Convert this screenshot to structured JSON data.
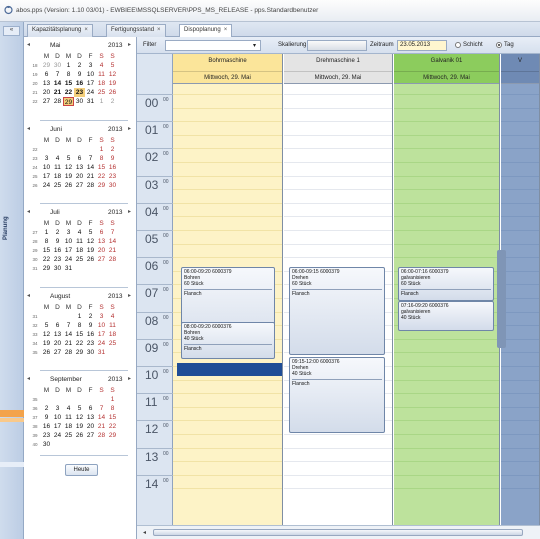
{
  "window": {
    "title": "abos.pps (Version: 1.10 03/01) - EWBIEE\\MSSQLSERVER\\PPS_MS_RELEASE - pps.Standardbenutzer"
  },
  "strip": {
    "top_button": "«",
    "label": "Planung"
  },
  "tabs": [
    {
      "label": "Kapazitätsplanung",
      "close": "×"
    },
    {
      "label": "Fertigungsstand",
      "close": "×"
    },
    {
      "label": "Dispoplanung",
      "close": "×"
    }
  ],
  "calendar": {
    "prev": "◂",
    "next": "▸",
    "weekday_headers": [
      "M",
      "D",
      "M",
      "D",
      "F",
      "S",
      "S"
    ],
    "today_button": "Heute",
    "months": [
      {
        "name": "Mai",
        "year": "2013",
        "weeks": [
          {
            "wk": "18",
            "days": [
              "29",
              "30",
              "1",
              "2",
              "3",
              "4",
              "5"
            ]
          },
          {
            "wk": "19",
            "days": [
              "6",
              "7",
              "8",
              "9",
              "10",
              "11",
              "12"
            ]
          },
          {
            "wk": "20",
            "days": [
              "13",
              "14",
              "15",
              "16",
              "17",
              "18",
              "19"
            ]
          },
          {
            "wk": "21",
            "days": [
              "20",
              "21",
              "22",
              "23",
              "24",
              "25",
              "26"
            ]
          },
          {
            "wk": "22",
            "days": [
              "27",
              "28",
              "29",
              "30",
              "31",
              "1",
              "2"
            ]
          }
        ]
      },
      {
        "name": "Juni",
        "year": "2013",
        "weeks": [
          {
            "wk": "22",
            "days": [
              "",
              "",
              "",
              "",
              "",
              "1",
              "2"
            ]
          },
          {
            "wk": "23",
            "days": [
              "3",
              "4",
              "5",
              "6",
              "7",
              "8",
              "9"
            ]
          },
          {
            "wk": "24",
            "days": [
              "10",
              "11",
              "12",
              "13",
              "14",
              "15",
              "16"
            ]
          },
          {
            "wk": "25",
            "days": [
              "17",
              "18",
              "19",
              "20",
              "21",
              "22",
              "23"
            ]
          },
          {
            "wk": "26",
            "days": [
              "24",
              "25",
              "26",
              "27",
              "28",
              "29",
              "30"
            ]
          }
        ]
      },
      {
        "name": "Juli",
        "year": "2013",
        "weeks": [
          {
            "wk": "27",
            "days": [
              "1",
              "2",
              "3",
              "4",
              "5",
              "6",
              "7"
            ]
          },
          {
            "wk": "28",
            "days": [
              "8",
              "9",
              "10",
              "11",
              "12",
              "13",
              "14"
            ]
          },
          {
            "wk": "29",
            "days": [
              "15",
              "16",
              "17",
              "18",
              "19",
              "20",
              "21"
            ]
          },
          {
            "wk": "30",
            "days": [
              "22",
              "23",
              "24",
              "25",
              "26",
              "27",
              "28"
            ]
          },
          {
            "wk": "31",
            "days": [
              "29",
              "30",
              "31",
              "",
              "",
              "",
              ""
            ]
          }
        ]
      },
      {
        "name": "August",
        "year": "2013",
        "weeks": [
          {
            "wk": "31",
            "days": [
              "",
              "",
              "",
              "1",
              "2",
              "3",
              "4"
            ]
          },
          {
            "wk": "32",
            "days": [
              "5",
              "6",
              "7",
              "8",
              "9",
              "10",
              "11"
            ]
          },
          {
            "wk": "33",
            "days": [
              "12",
              "13",
              "14",
              "15",
              "16",
              "17",
              "18"
            ]
          },
          {
            "wk": "34",
            "days": [
              "19",
              "20",
              "21",
              "22",
              "23",
              "24",
              "25"
            ]
          },
          {
            "wk": "35",
            "days": [
              "26",
              "27",
              "28",
              "29",
              "30",
              "31",
              ""
            ]
          }
        ]
      },
      {
        "name": "September",
        "year": "2013",
        "weeks": [
          {
            "wk": "35",
            "days": [
              "",
              "",
              "",
              "",
              "",
              "",
              "1"
            ]
          },
          {
            "wk": "36",
            "days": [
              "2",
              "3",
              "4",
              "5",
              "6",
              "7",
              "8"
            ]
          },
          {
            "wk": "37",
            "days": [
              "9",
              "10",
              "11",
              "12",
              "13",
              "14",
              "15"
            ]
          },
          {
            "wk": "38",
            "days": [
              "16",
              "17",
              "18",
              "19",
              "20",
              "21",
              "22"
            ]
          },
          {
            "wk": "39",
            "days": [
              "23",
              "24",
              "25",
              "26",
              "27",
              "28",
              "29"
            ]
          },
          {
            "wk": "40",
            "days": [
              "30",
              "",
              "",
              "",
              "",
              "",
              ""
            ]
          }
        ]
      }
    ]
  },
  "filter_bar": {
    "filter_label": "Filter",
    "filter_value": "",
    "skalierung_label": "Skalierung",
    "zeitraum_label": "Zeitraum",
    "zeitraum_value": "23.05.2013",
    "options": [
      "Schicht",
      "Tag"
    ],
    "selected_option": "Tag"
  },
  "schedule": {
    "hours": [
      "00",
      "01",
      "02",
      "03",
      "04",
      "05",
      "06",
      "07",
      "08",
      "09",
      "10",
      "11",
      "12",
      "13",
      "14"
    ],
    "minutes": "00",
    "columns": [
      {
        "name": "Bohrmaschine",
        "date": "Mittwoch, 29. Mai",
        "bg": "#fdf3c7",
        "head_bg": "#fbe59a",
        "line": "#f1e3a6"
      },
      {
        "name": "Drehmaschine 1",
        "date": "Mittwoch, 29. Mai",
        "bg": "#ffffff",
        "head_bg": "#e4e4e4",
        "line": "#e5e8ee"
      },
      {
        "name": "Galvanik 01",
        "date": "Mittwoch, 29. Mai",
        "bg": "#bde29c",
        "head_bg": "#8ccc5d",
        "line": "#a9d686"
      },
      {
        "name": "V",
        "date": "",
        "bg": "#8aa3c8",
        "head_bg": "#6f8ab4",
        "line": "#7d98c0"
      }
    ],
    "appointments": [
      {
        "col": 0,
        "lines": [
          "06:00-09:20 6000379",
          "Bohren",
          "60 Stück"
        ],
        "material": "Flansch"
      },
      {
        "col": 0,
        "lines": [
          "08:00-09:20 6000376",
          "Bohren",
          "40 Stück"
        ],
        "material": "Flansch"
      },
      {
        "col": 1,
        "lines": [
          "06:00-09:15 6000379",
          "Drehen",
          "60 Stück"
        ],
        "material": "Flansch"
      },
      {
        "col": 1,
        "lines": [
          "09:15-12:00 6000376",
          "Drehen",
          "40 Stück"
        ],
        "material": "Flansch"
      },
      {
        "col": 2,
        "lines": [
          "06:00-07:16 6000379",
          "galvanisieren",
          "60 Stück"
        ],
        "material": "Flansch"
      },
      {
        "col": 2,
        "lines": [
          "07:16-09:20 6000376",
          "galvanisieren",
          "40 Stück"
        ],
        "material": ""
      }
    ]
  },
  "colors": {
    "accent": "#1f4d96",
    "selected_day": "#f4cf7b",
    "weekend": "#b43030"
  }
}
